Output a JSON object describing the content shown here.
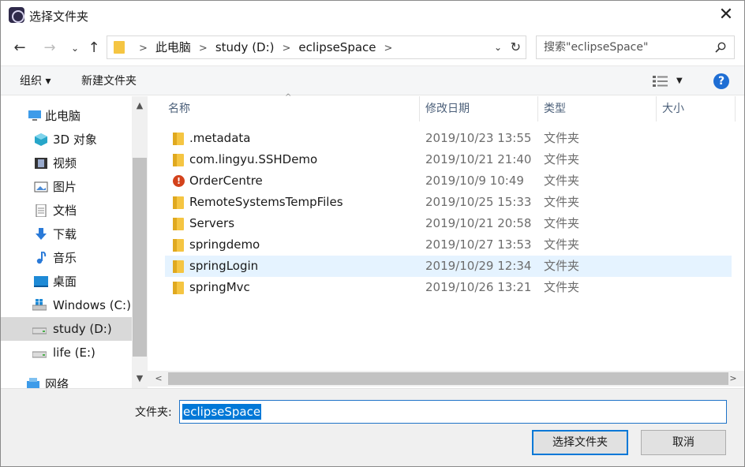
{
  "window": {
    "title": "选择文件夹",
    "close_glyph": "✕"
  },
  "nav": {
    "back_glyph": "←",
    "forward_glyph": "→",
    "recent_glyph": "⌄",
    "up_glyph": "↑",
    "breadcrumb": [
      "此电脑",
      "study (D:)",
      "eclipseSpace"
    ],
    "refresh_glyph": "↻",
    "search_placeholder": "搜索\"eclipseSpace\""
  },
  "toolbar": {
    "organize_label": "组织 ▾",
    "new_folder_label": "新建文件夹",
    "view_dd_glyph": "▼",
    "help_glyph": "?"
  },
  "sidebar": {
    "items": [
      {
        "label": "此电脑",
        "icon": "pc-icon"
      },
      {
        "label": "3D 对象",
        "icon": "cube-icon"
      },
      {
        "label": "视频",
        "icon": "video-icon"
      },
      {
        "label": "图片",
        "icon": "picture-icon"
      },
      {
        "label": "文档",
        "icon": "document-icon"
      },
      {
        "label": "下载",
        "icon": "download-icon"
      },
      {
        "label": "音乐",
        "icon": "music-icon"
      },
      {
        "label": "桌面",
        "icon": "desktop-icon"
      },
      {
        "label": "Windows (C:)",
        "icon": "windows-drive-icon"
      },
      {
        "label": "study (D:)",
        "icon": "drive-icon",
        "selected": true
      },
      {
        "label": "life (E:)",
        "icon": "drive-icon"
      },
      {
        "label": "网络",
        "icon": "network-icon"
      }
    ],
    "scroll_up_glyph": "▲",
    "scroll_down_glyph": "▼"
  },
  "columns": {
    "name": "名称",
    "modified": "修改日期",
    "type": "类型",
    "size": "大小",
    "sort_glyph": "^"
  },
  "files": [
    {
      "name": ".metadata",
      "modified": "2019/10/23 13:55",
      "type": "文件夹",
      "icon": "folder-icon"
    },
    {
      "name": "com.lingyu.SSHDemo",
      "modified": "2019/10/21 21:40",
      "type": "文件夹",
      "icon": "folder-icon"
    },
    {
      "name": "OrderCentre",
      "modified": "2019/10/9 10:49",
      "type": "文件夹",
      "icon": "project-error-icon"
    },
    {
      "name": "RemoteSystemsTempFiles",
      "modified": "2019/10/25 15:33",
      "type": "文件夹",
      "icon": "folder-icon"
    },
    {
      "name": "Servers",
      "modified": "2019/10/21 20:58",
      "type": "文件夹",
      "icon": "folder-icon"
    },
    {
      "name": "springdemo",
      "modified": "2019/10/27 13:53",
      "type": "文件夹",
      "icon": "folder-icon"
    },
    {
      "name": "springLogin",
      "modified": "2019/10/29 12:34",
      "type": "文件夹",
      "icon": "folder-icon",
      "selected": true
    },
    {
      "name": "springMvc",
      "modified": "2019/10/26 13:21",
      "type": "文件夹",
      "icon": "folder-icon"
    }
  ],
  "hscroll": {
    "left_glyph": "<",
    "right_glyph": ">"
  },
  "footer": {
    "folder_label": "文件夹:",
    "folder_value": "eclipseSpace",
    "select_button": "选择文件夹",
    "cancel_button": "取消"
  },
  "colors": {
    "accent": "#0078d7",
    "selected_row": "#e5f3ff",
    "folder": "#f5c542"
  }
}
